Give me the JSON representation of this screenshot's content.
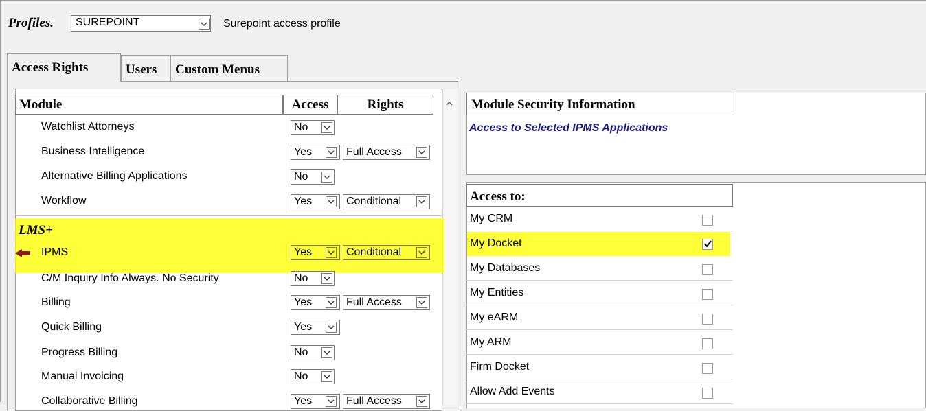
{
  "profile": {
    "label": "Profiles.",
    "value": "SUREPOINT",
    "description": "Surepoint access profile"
  },
  "tabs": [
    {
      "label": "Access Rights",
      "active": true
    },
    {
      "label": "Users",
      "active": false
    },
    {
      "label": "Custom Menus",
      "active": false
    }
  ],
  "grid": {
    "headers": {
      "module": "Module",
      "access": "Access",
      "rights": "Rights"
    },
    "rows": [
      {
        "label": "Watchlist Attorneys",
        "access": "No",
        "rights": ""
      },
      {
        "label": "Business Intelligence",
        "access": "Yes",
        "rights": "Full Access"
      },
      {
        "label": "Alternative Billing Applications",
        "access": "No",
        "rights": ""
      },
      {
        "label": "Workflow",
        "access": "Yes",
        "rights": "Conditional"
      }
    ],
    "section": "LMS+",
    "section_rows": [
      {
        "label": "IPMS",
        "access": "Yes",
        "rights": "Conditional",
        "selected": true
      },
      {
        "label": "C/M Inquiry Info Always. No Security",
        "access": "No",
        "rights": ""
      },
      {
        "label": "Billing",
        "access": "Yes",
        "rights": "Full Access"
      },
      {
        "label": "Quick Billing",
        "access": "Yes",
        "rights": ""
      },
      {
        "label": "Progress Billing",
        "access": "No",
        "rights": ""
      },
      {
        "label": "Manual Invoicing",
        "access": "No",
        "rights": ""
      },
      {
        "label": "Collaborative Billing",
        "access": "Yes",
        "rights": "Full Access"
      }
    ]
  },
  "security_info": {
    "header": "Module Security Information",
    "text": "Access to Selected IPMS Applications"
  },
  "access_to": {
    "header": "Access to:",
    "items": [
      {
        "label": "My CRM",
        "checked": false
      },
      {
        "label": "My Docket",
        "checked": true
      },
      {
        "label": "My Databases",
        "checked": false
      },
      {
        "label": "My Entities",
        "checked": false
      },
      {
        "label": "My eARM",
        "checked": false
      },
      {
        "label": "My ARM",
        "checked": false
      },
      {
        "label": "Firm Docket",
        "checked": false
      },
      {
        "label": "Allow Add Events",
        "checked": false
      }
    ]
  },
  "colors": {
    "highlight": "#ffff00",
    "info_text": "#1a1a80",
    "pointer": "#8b1a1a"
  }
}
